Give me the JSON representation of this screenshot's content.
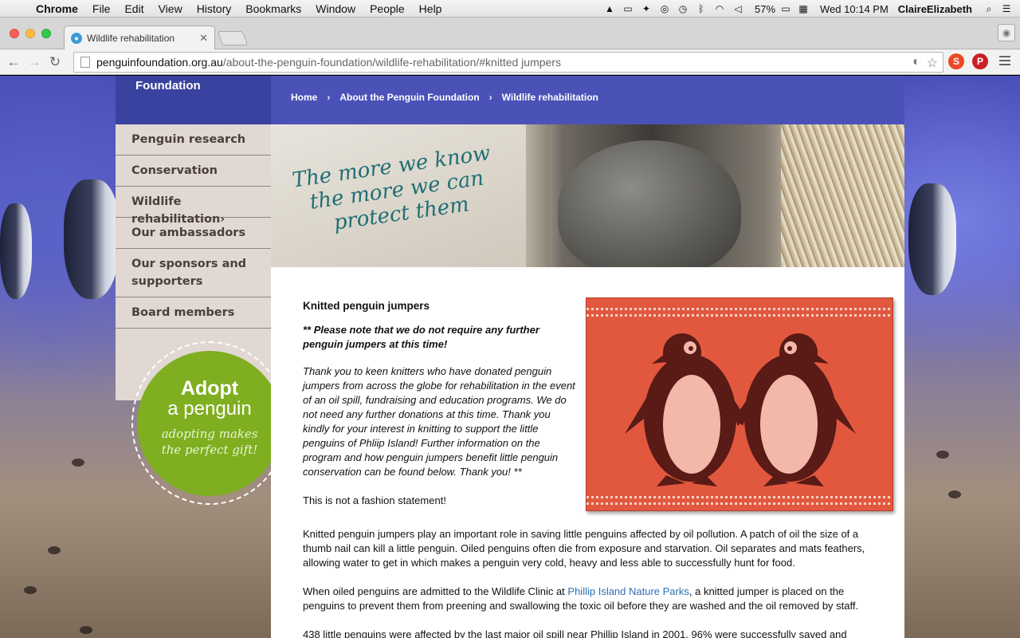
{
  "menubar": {
    "app": "Chrome",
    "menus": [
      "File",
      "Edit",
      "View",
      "History",
      "Bookmarks",
      "Window",
      "People",
      "Help"
    ],
    "battery": "57%",
    "clock": "Wed 10:14 PM",
    "user": "ClaireElizabeth"
  },
  "browser": {
    "tab_title": "Wildlife rehabilitation",
    "url_host": "penguinfoundation.org.au",
    "url_path": "/about-the-penguin-foundation/wildlife-rehabilitation/#knitted jumpers"
  },
  "site": {
    "logo_text": "Foundation",
    "breadcrumb": [
      "Home",
      "About the Penguin Foundation",
      "Wildlife rehabilitation"
    ],
    "breadcrumb_sep": "›",
    "sidebar": [
      "Penguin research",
      "Conservation",
      "Wildlife rehabilitation›",
      "Our ambassadors",
      "Our sponsors and supporters",
      "Board members"
    ],
    "adopt": {
      "line1": "Adopt",
      "line2": "a penguin",
      "line3": "adopting makes",
      "line4": "the perfect gift!"
    },
    "hero_slogan": [
      "The more we know",
      "the more we can",
      "protect them"
    ]
  },
  "article": {
    "heading": "Knitted penguin jumpers",
    "note": "** Please note that we do not require any further penguin jumpers at this time!",
    "thanks": "Thank you to keen knitters who have donated penguin jumpers from across the globe for rehabilitation in the event of an oil spill, fundraising and education programs. We do not need any further donations at this time. Thank you kindly for your interest in knitting to support the little penguins of Phliip Island! Further information on the program and how penguin jumpers benefit little penguin conservation can be found below. Thank you! **",
    "not_fashion": "This is not a fashion statement!",
    "para1": "Knitted penguin jumpers play an important role in saving little penguins affected by oil pollution. A patch of oil the size of a thumb nail can kill a little penguin. Oiled penguins often die from exposure and starvation. Oil separates and mats feathers, allowing water to get in which makes a penguin very cold, heavy and less able to successfully hunt for food.",
    "para2_before": "When oiled penguins are admitted to the Wildlife Clinic at ",
    "para2_link": "Phillip Island Nature Parks",
    "para2_after": ", a knitted jumper is placed on the penguins to prevent them from preening and swallowing the toxic oil before they are washed and the oil removed by staff.",
    "para3": "438 little penguins were affected by the last major oil spill near Phillip Island in 2001. 96% were successfully saved and"
  },
  "colors": {
    "header_blue": "#4a52b8",
    "sidebar_bg": "#e1d8d3",
    "adopt_green": "#7fae21",
    "knit_red": "#e2583f",
    "link": "#2f6fb5"
  }
}
